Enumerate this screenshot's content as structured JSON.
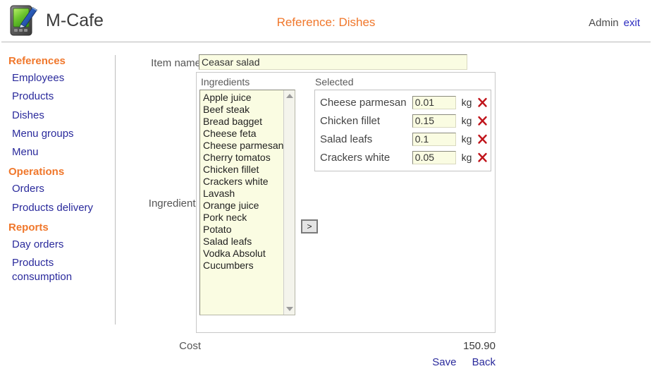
{
  "header": {
    "logo_icon": "pda-stylus-icon",
    "app_title": "M-Cafe",
    "page_heading": "Reference: Dishes",
    "user_name": "Admin",
    "exit_label": "exit",
    "accent_color": "#f0772b",
    "link_color": "#2a2a9c"
  },
  "sidebar": {
    "groups": [
      {
        "title": "References",
        "items": [
          {
            "label": "Employees"
          },
          {
            "label": "Products"
          },
          {
            "label": "Dishes"
          },
          {
            "label": "Menu groups"
          },
          {
            "label": "Menu"
          }
        ]
      },
      {
        "title": "Operations",
        "items": [
          {
            "label": "Orders"
          },
          {
            "label": "Products delivery"
          }
        ]
      },
      {
        "title": "Reports",
        "items": [
          {
            "label": "Day orders"
          },
          {
            "label": "Products consumption"
          }
        ]
      }
    ]
  },
  "form": {
    "item_name_label": "Item name",
    "item_name_value": "Ceasar salad",
    "item_name_placeholder": "",
    "ingredients_label": "Ingredients",
    "available_title": "Ingredients",
    "selected_title": "Selected",
    "transfer_button_label": ">",
    "available_options": [
      "Apple juice",
      "Beef steak",
      "Bread bagget",
      "Cheese feta",
      "Cheese parmesan",
      "Cherry tomatos",
      "Chicken fillet",
      "Crackers white",
      "Lavash",
      "Orange juice",
      "Pork neck",
      "Potato",
      "Salad leafs",
      "Vodka Absolut",
      "Cucumbers"
    ],
    "selected_rows": [
      {
        "name": "Cheese parmesan",
        "qty": "0.01",
        "unit": "kg",
        "delete_icon": "red-x-icon"
      },
      {
        "name": "Chicken fillet",
        "qty": "0.15",
        "unit": "kg",
        "delete_icon": "red-x-icon"
      },
      {
        "name": "Salad leafs",
        "qty": "0.1",
        "unit": "kg",
        "delete_icon": "red-x-icon"
      },
      {
        "name": "Crackers white",
        "qty": "0.05",
        "unit": "kg",
        "delete_icon": "red-x-icon"
      }
    ],
    "cost_label": "Cost",
    "cost_value": "150.90",
    "save_label": "Save",
    "back_label": "Back"
  }
}
